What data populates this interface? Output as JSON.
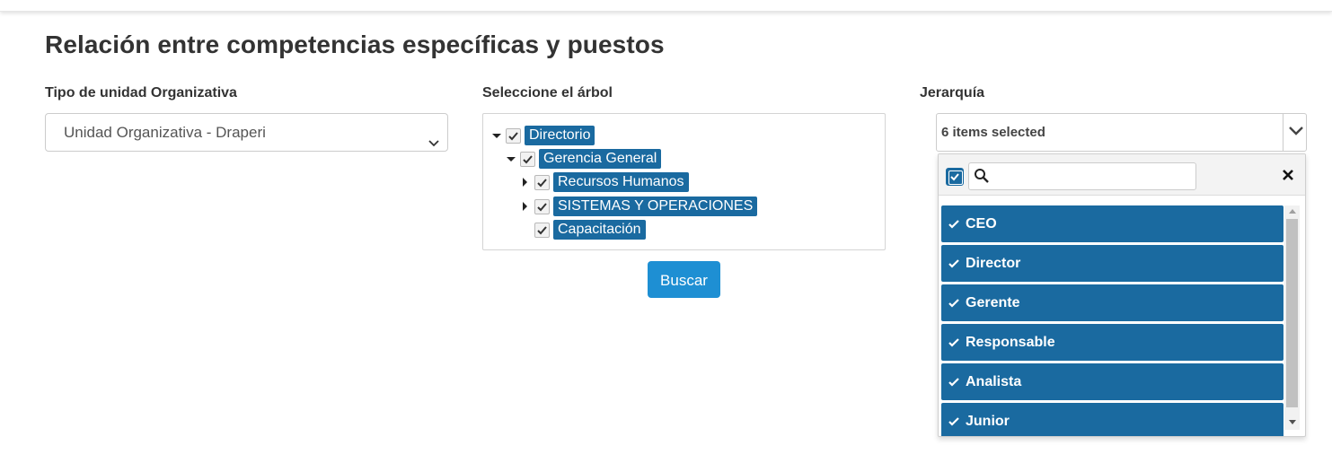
{
  "page": {
    "title": "Relación entre competencias específicas y puestos"
  },
  "unit_type": {
    "label": "Tipo de unidad Organizativa",
    "selected": "Unidad Organizativa - Draperi"
  },
  "tree": {
    "label": "Seleccione el árbol",
    "nodes": [
      {
        "label": "Directorio",
        "expander": "expanded",
        "checked": true
      },
      {
        "label": "Gerencia General",
        "expander": "expanded",
        "checked": true
      },
      {
        "label": "Recursos Humanos",
        "expander": "collapsed",
        "checked": true
      },
      {
        "label": "SISTEMAS Y OPERACIONES",
        "expander": "collapsed",
        "checked": true
      },
      {
        "label": "Capacitación",
        "expander": "none",
        "checked": true
      }
    ]
  },
  "search_button": {
    "label": "Buscar"
  },
  "hierarchy": {
    "label": "Jerarquía",
    "summary": "6 items selected",
    "search_placeholder": "",
    "options": [
      {
        "label": "CEO",
        "selected": true
      },
      {
        "label": "Director",
        "selected": true
      },
      {
        "label": "Gerente",
        "selected": true
      },
      {
        "label": "Responsable",
        "selected": true
      },
      {
        "label": "Analista",
        "selected": true
      },
      {
        "label": "Junior",
        "selected": true
      }
    ]
  },
  "icons": {
    "select_chevron": "chevron-down-icon",
    "tree_expanded": "caret-down-icon",
    "tree_collapsed": "caret-right-icon",
    "checkbox": "check-icon",
    "search": "search-icon",
    "clear": "close-icon"
  },
  "colors": {
    "selection": "#1a6aa0",
    "primary_button": "#1e8fd3",
    "border": "#cccccc",
    "text": "#333333"
  }
}
